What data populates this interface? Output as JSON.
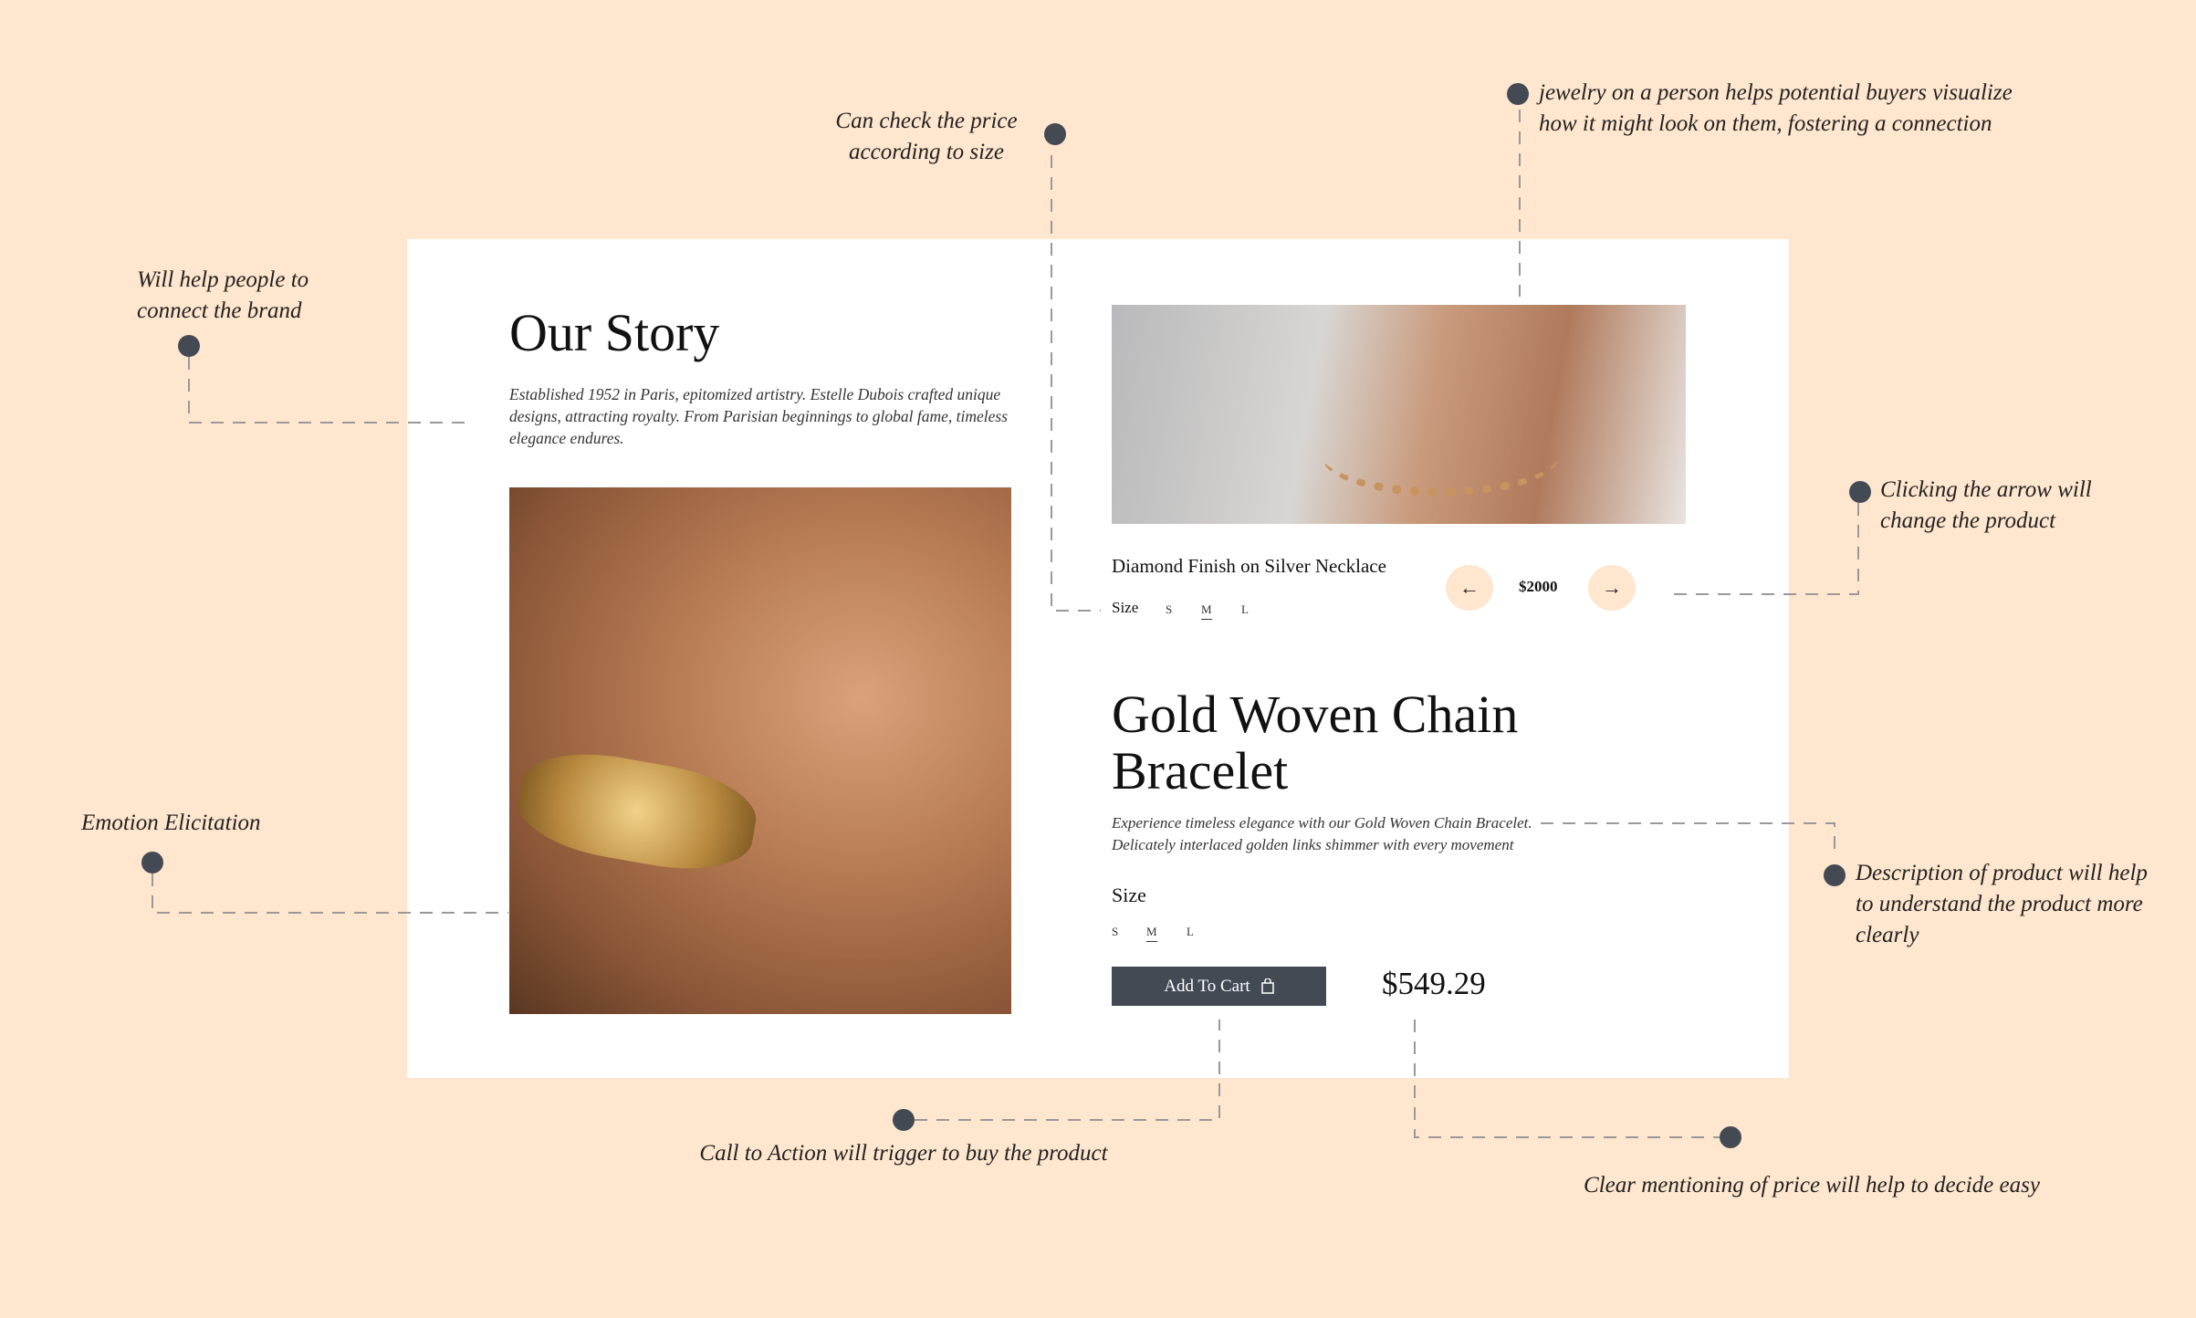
{
  "story": {
    "title": "Our Story",
    "text": "Established 1952 in Paris, epitomized artistry. Estelle Dubois crafted unique designs, attracting royalty. From Parisian beginnings to global fame, timeless elegance endures."
  },
  "carousel": {
    "name": "Diamond Finish on Silver Necklace",
    "size_label": "Size",
    "sizes": [
      "S",
      "M",
      "L"
    ],
    "selected": "M",
    "price": "$2000",
    "prev_icon": "arrow-left-icon",
    "next_icon": "arrow-right-icon"
  },
  "product": {
    "title_line1": "Gold Woven Chain",
    "title_line2": "Bracelet",
    "description_line1": "Experience timeless elegance with our Gold Woven Chain Bracelet.",
    "description_line2": "Delicately interlaced golden links shimmer with every movement",
    "size_label": "Size",
    "sizes": [
      "S",
      "M",
      "L"
    ],
    "selected": "M",
    "add_to_cart": "Add To Cart",
    "price": "$549.29"
  },
  "annotations": {
    "brand": [
      "Will help people to",
      "connect the brand"
    ],
    "size_price": [
      "Can check the price",
      "according to size"
    ],
    "person": [
      "jewelry on a person helps potential buyers visualize",
      "how it might look on them, fostering a connection"
    ],
    "arrow": [
      "Clicking the arrow will",
      "change the product"
    ],
    "description": [
      "Description of product will help",
      "to understand the product more",
      "clearly"
    ],
    "emotion": "Emotion Elicitation",
    "cta": "Call to Action will trigger to buy the product",
    "price": "Clear mentioning of price will help to decide easy"
  },
  "colors": {
    "background": "#FFE6CF",
    "dark": "#434A54",
    "card": "#FFFFFF"
  }
}
